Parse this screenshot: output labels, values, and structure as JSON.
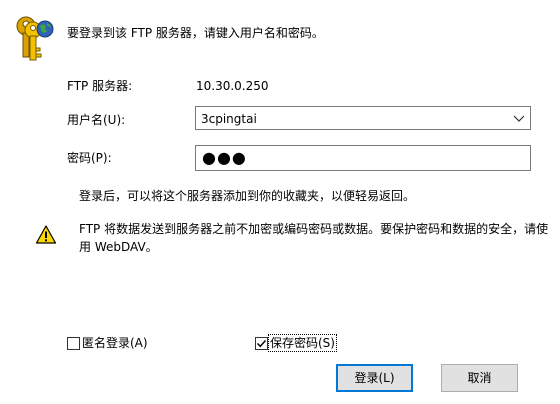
{
  "dialog": {
    "prompt": "要登录到该 FTP 服务器，请键入用户名和密码。",
    "server_label": "FTP 服务器:",
    "server_value": "10.30.0.250",
    "username_label": "用户名(U):",
    "username_value": "3cpingtai",
    "password_label": "密码(P):",
    "password_value": "●●●",
    "info_text": "登录后，可以将这个服务器添加到你的收藏夹，以便轻易返回。",
    "warning_text": "FTP 将数据发送到服务器之前不加密或编码密码或数据。要保护密码和数据的安全，请使用 WebDAV。",
    "anonymous_label": "匿名登录(A)",
    "anonymous_checked": false,
    "save_password_label": "保存密码(S)",
    "save_password_checked": true,
    "login_button": "登录(L)",
    "cancel_button": "取消"
  },
  "icons": {
    "main": "keys-globe-icon",
    "warning": "warning-icon",
    "dropdown": "chevron-down-icon",
    "checkmark": "checkmark-icon"
  },
  "colors": {
    "focus_border": "#0078d7",
    "button_face": "#e1e1e1",
    "warning_yellow": "#ffd800"
  }
}
